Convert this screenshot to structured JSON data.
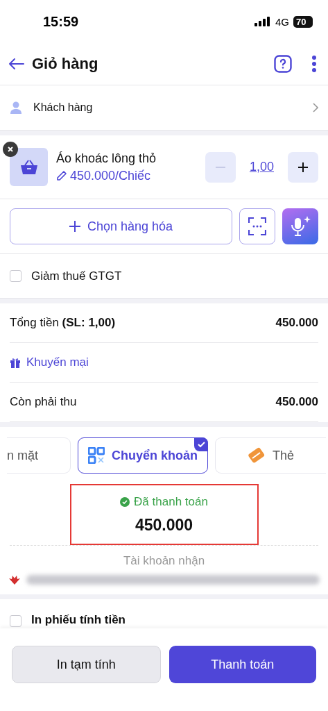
{
  "status_bar": {
    "time": "15:59",
    "network": "4G",
    "battery": "70"
  },
  "header": {
    "title": "Giỏ hàng"
  },
  "customer": {
    "label": "Khách hàng"
  },
  "items": [
    {
      "name": "Áo khoác lông thỏ",
      "price": "450.000/Chiếc",
      "quantity": "1,00",
      "decrease_disabled": true
    }
  ],
  "add_product": {
    "label": "Chọn hàng hóa"
  },
  "vat_reduction": {
    "label": "Giảm thuế GTGT",
    "checked": false
  },
  "totals": [
    {
      "kind": "total",
      "label": "Tổng tiền **(SL: 1,00)**",
      "value": "450.000"
    },
    {
      "kind": "promotion",
      "label": "Khuyến mại"
    },
    {
      "kind": "remaining",
      "label": "Còn phải thu",
      "value": "450.000"
    }
  ],
  "payment_methods": [
    {
      "label": "n mặt",
      "selected": false
    },
    {
      "label": "Chuyển khoản",
      "selected": true,
      "kind": "qr"
    },
    {
      "label": "Thẻ",
      "selected": false,
      "kind": "card"
    }
  ],
  "payment_status": {
    "status": "Đã thanh toán",
    "amount": "450.000"
  },
  "receiving_account": {
    "label": "Tài khoản nhận"
  },
  "print_receipt": {
    "label": "In phiếu tính tiền",
    "checked": false
  },
  "actions": [
    {
      "label": "In tạm tính",
      "kind": "secondary"
    },
    {
      "label": "Thanh toán",
      "kind": "primary"
    }
  ]
}
